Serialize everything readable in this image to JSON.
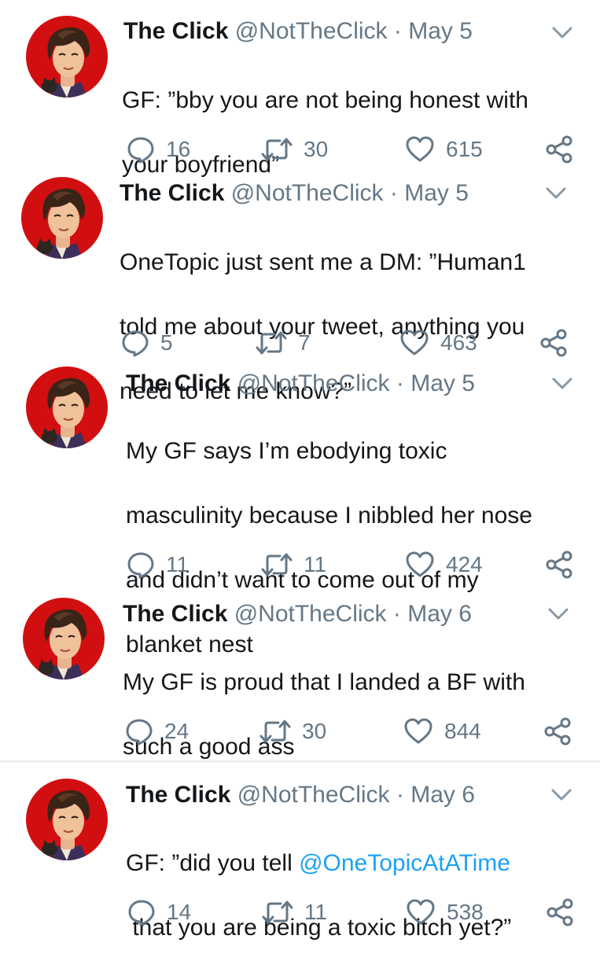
{
  "colors": {
    "text": "#14171a",
    "muted": "#657786",
    "link": "#1da1f2",
    "avatar_bg": "#d10f10",
    "divider": "#e6ecf0"
  },
  "icons": {
    "reply": "reply-icon",
    "retweet": "retweet-icon",
    "like": "heart-icon",
    "share": "share-icon",
    "menu": "chevron-down-icon"
  },
  "tweets": [
    {
      "name": "The Click",
      "handle": "@NotTheClick",
      "separator": " · ",
      "date": "May 5",
      "text_lines": [
        "GF: ”bby you are not being honest with",
        "your boyfriend”"
      ],
      "replies": "16",
      "retweets": "30",
      "likes": "615"
    },
    {
      "name": "The Click",
      "handle": "@NotTheClick",
      "separator": " · ",
      "date": "May 5",
      "text_lines": [
        "OneTopic just sent me a DM: ”Human1",
        "told me about your tweet, anything you",
        "need to let me know?”"
      ],
      "replies": "5",
      "retweets": "7",
      "likes": "463"
    },
    {
      "name": "The Click",
      "handle": "@NotTheClick",
      "separator": " · ",
      "date": "May 5",
      "text_lines": [
        "My GF says I’m ebodying toxic",
        "masculinity because I nibbled her nose",
        "and didn’t want to come out of my",
        "blanket nest"
      ],
      "replies": "11",
      "retweets": "11",
      "likes": "424"
    },
    {
      "name": "The Click",
      "handle": "@NotTheClick",
      "separator": " · ",
      "date": "May 6",
      "text_lines": [
        "My GF is proud that I landed a BF with",
        "such a good ass"
      ],
      "replies": "24",
      "retweets": "30",
      "likes": "844"
    },
    {
      "name": "The Click",
      "handle": "@NotTheClick",
      "separator": " · ",
      "date": "May 6",
      "text_prefix": "GF: ”did you tell ",
      "mention": "@OneTopicAtATime",
      "text_line2": " that you are being a toxic bitch yet?”",
      "replies": "14",
      "retweets": "11",
      "likes": "538"
    }
  ]
}
